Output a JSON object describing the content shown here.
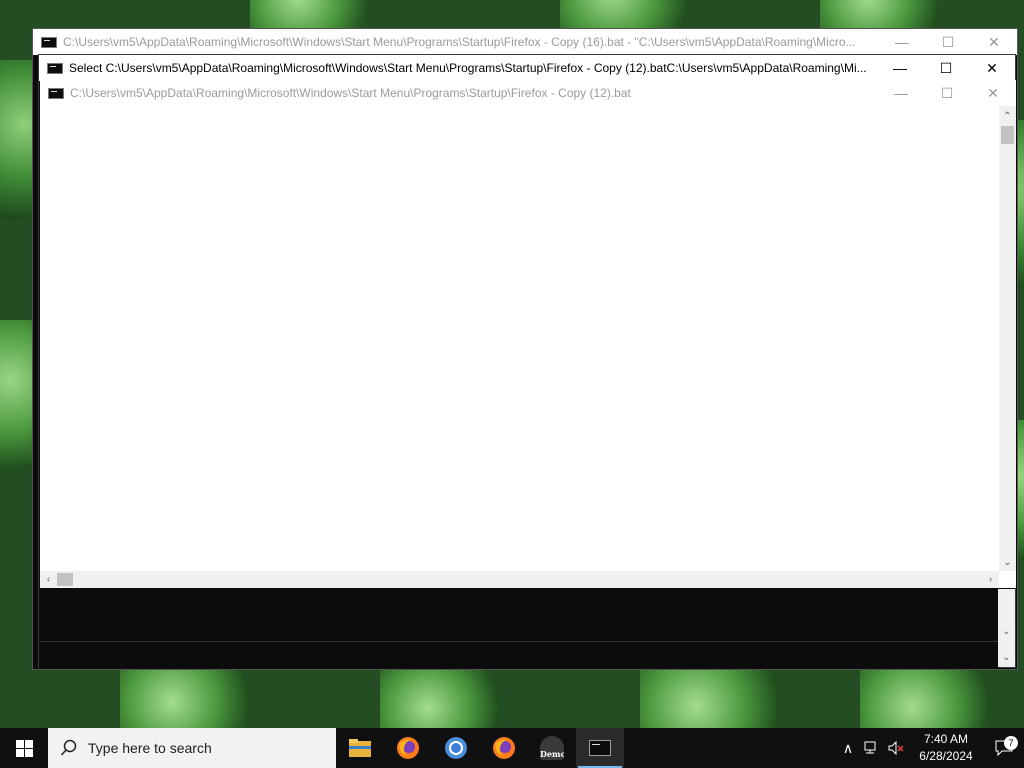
{
  "windows": {
    "back": {
      "title": "C:\\Users\\vm5\\AppData\\Roaming\\Microsoft\\Windows\\Start Menu\\Programs\\Startup\\Firefox - Copy (16).bat - \"C:\\Users\\vm5\\AppData\\Roaming\\Micro..."
    },
    "middle": {
      "title": "Select C:\\Users\\vm5\\AppData\\Roaming\\Microsoft\\Windows\\Start Menu\\Programs\\Startup\\Firefox - Copy (12).batC:\\Users\\vm5\\AppData\\Roaming\\Mi..."
    },
    "front": {
      "title": "C:\\Users\\vm5\\AppData\\Roaming\\Microsoft\\Windows\\Start Menu\\Programs\\Startup\\Firefox - Copy (12).bat"
    },
    "controls": {
      "minimize": "—",
      "maximize": "☐",
      "close": "✕"
    }
  },
  "taskbar": {
    "search_placeholder": "Type here to search",
    "apps": [
      "file-explorer",
      "firefox",
      "chrome",
      "firefox",
      "demo",
      "command-prompt"
    ],
    "demo_label": "Demo",
    "clock_time": "7:40 AM",
    "clock_date": "6/28/2024",
    "notification_count": "7"
  },
  "colors": {
    "taskbar": "#101010",
    "accent": "#76b9ed"
  }
}
